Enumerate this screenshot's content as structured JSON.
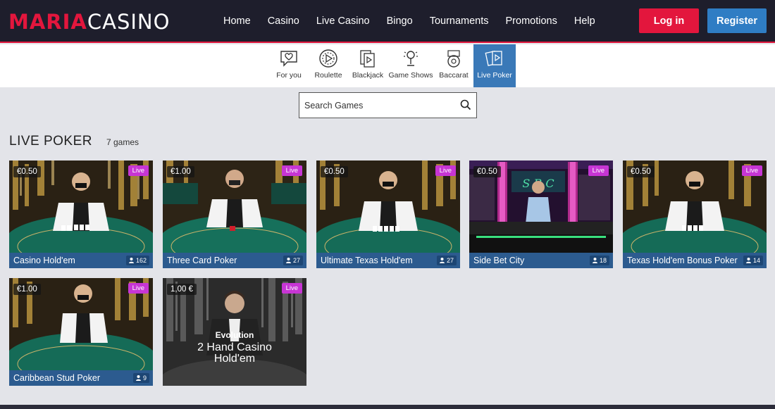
{
  "header": {
    "logo_part1": "MARIA",
    "logo_part2": "CASINO",
    "nav": [
      "Home",
      "Casino",
      "Live Casino",
      "Bingo",
      "Tournaments",
      "Promotions",
      "Help"
    ],
    "login_label": "Log in",
    "register_label": "Register"
  },
  "categories": [
    {
      "label": "For you",
      "icon": "heart-chat-icon"
    },
    {
      "label": "Roulette",
      "icon": "roulette-icon"
    },
    {
      "label": "Blackjack",
      "icon": "cards-play-icon"
    },
    {
      "label": "Game Shows",
      "icon": "microphone-icon"
    },
    {
      "label": "Baccarat",
      "icon": "baccarat-icon"
    },
    {
      "label": "Live Poker",
      "icon": "poker-cards-icon",
      "active": true
    }
  ],
  "search": {
    "placeholder": "Search Games"
  },
  "section": {
    "title": "LIVE POKER",
    "count": "7 games"
  },
  "games": [
    {
      "name": "Casino Hold'em",
      "bet": "€0.50",
      "badge": "Live",
      "players": "162"
    },
    {
      "name": "Three Card Poker",
      "bet": "€1.00",
      "badge": "Live",
      "players": "27"
    },
    {
      "name": "Ultimate Texas Hold'em",
      "bet": "€0.50",
      "badge": "Live",
      "players": "27"
    },
    {
      "name": "Side Bet City",
      "bet": "€0.50",
      "badge": "Live",
      "players": "18"
    },
    {
      "name": "Texas Hold'em Bonus Poker",
      "bet": "€0.50",
      "badge": "Live",
      "players": "14"
    },
    {
      "name": "Caribbean Stud Poker",
      "bet": "€1.00",
      "badge": "Live",
      "players": "9"
    },
    {
      "name": "",
      "bet": "1,00 €",
      "badge": "Live",
      "brand": "Evolution",
      "art_title": "2 Hand Casino Hold'em"
    }
  ],
  "colors": {
    "brand_red": "#e3163d",
    "brand_blue": "#2f7dc4",
    "header_bg": "#1e1e2c",
    "caption_blue": "#2c5b8f",
    "live_badge": "#c735d4"
  }
}
